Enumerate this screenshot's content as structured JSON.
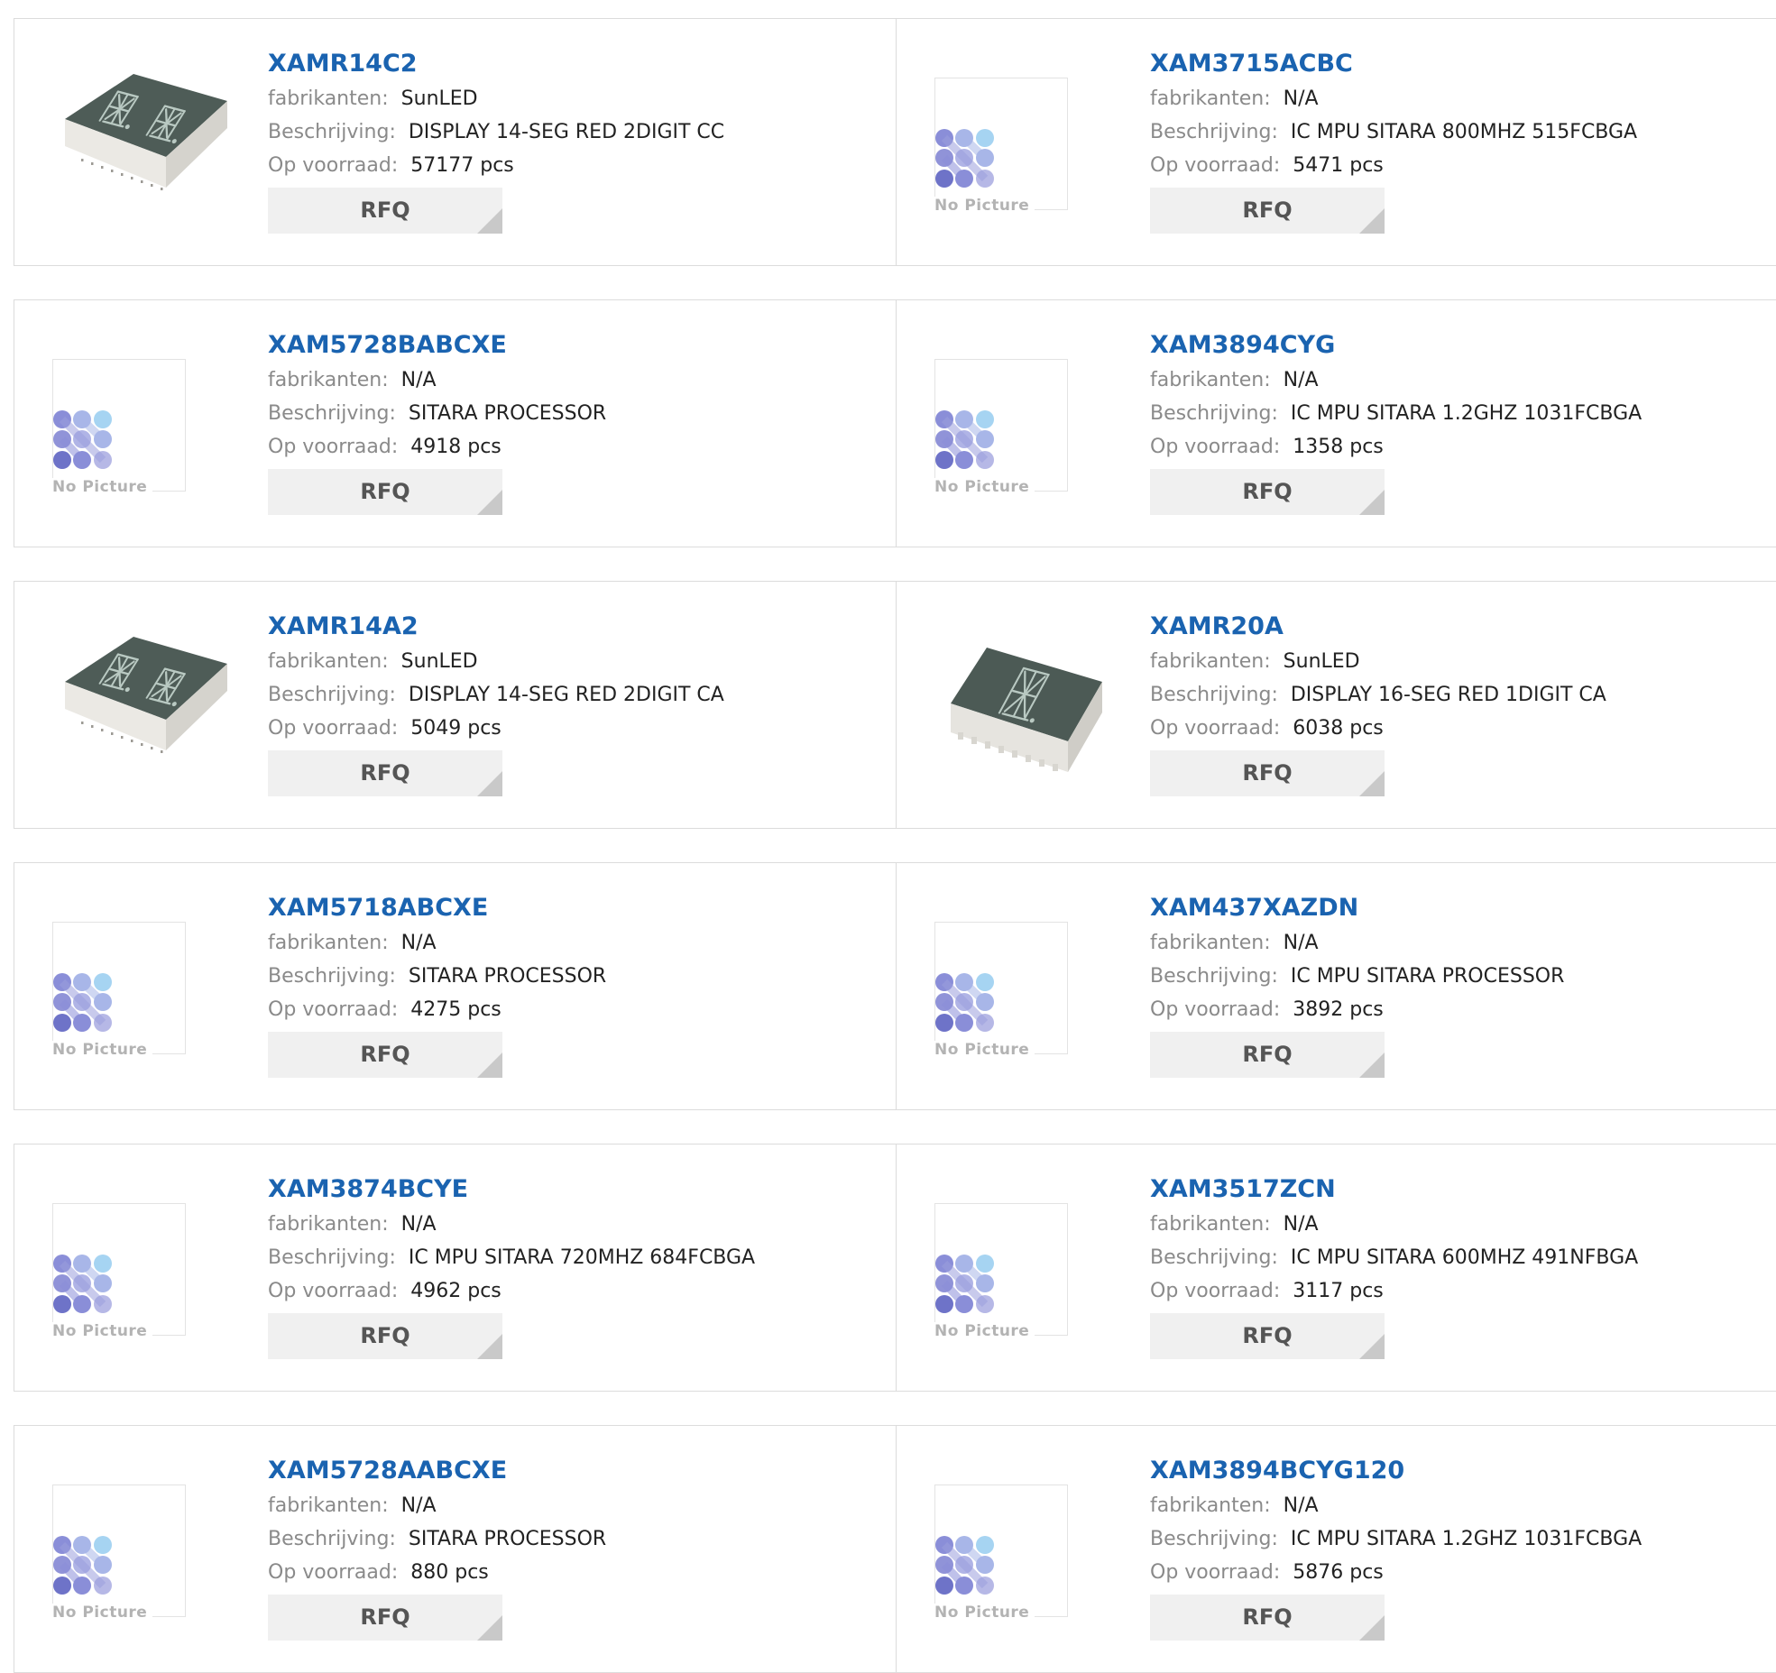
{
  "labels": {
    "manufacturer": "fabrikanten:",
    "description": "Beschrijving:",
    "stock": "Op voorraad:",
    "rfq": "RFQ",
    "no_picture": "No Picture"
  },
  "products": [
    {
      "part": "XAMR14C2",
      "manufacturer": "SunLED",
      "description": "DISPLAY 14-SEG RED 2DIGIT CC",
      "stock": "57177 pcs",
      "image": "led-2digit-icon"
    },
    {
      "part": "XAM3715ACBC",
      "manufacturer": "N/A",
      "description": "IC MPU SITARA 800MHZ 515FCBGA",
      "stock": "5471 pcs",
      "image": "no-picture-icon"
    },
    {
      "part": "XAM5728BABCXE",
      "manufacturer": "N/A",
      "description": "SITARA PROCESSOR",
      "stock": "4918 pcs",
      "image": "no-picture-icon"
    },
    {
      "part": "XAM3894CYG",
      "manufacturer": "N/A",
      "description": "IC MPU SITARA 1.2GHZ 1031FCBGA",
      "stock": "1358 pcs",
      "image": "no-picture-icon"
    },
    {
      "part": "XAMR14A2",
      "manufacturer": "SunLED",
      "description": "DISPLAY 14-SEG RED 2DIGIT CA",
      "stock": "5049 pcs",
      "image": "led-2digit-icon"
    },
    {
      "part": "XAMR20A",
      "manufacturer": "SunLED",
      "description": "DISPLAY 16-SEG RED 1DIGIT CA",
      "stock": "6038 pcs",
      "image": "led-1digit-icon"
    },
    {
      "part": "XAM5718ABCXE",
      "manufacturer": "N/A",
      "description": "SITARA PROCESSOR",
      "stock": "4275 pcs",
      "image": "no-picture-icon"
    },
    {
      "part": "XAM437XAZDN",
      "manufacturer": "N/A",
      "description": "IC MPU SITARA PROCESSOR",
      "stock": "3892 pcs",
      "image": "no-picture-icon"
    },
    {
      "part": "XAM3874BCYE",
      "manufacturer": "N/A",
      "description": "IC MPU SITARA 720MHZ 684FCBGA",
      "stock": "4962 pcs",
      "image": "no-picture-icon"
    },
    {
      "part": "XAM3517ZCN",
      "manufacturer": "N/A",
      "description": "IC MPU SITARA 600MHZ 491NFBGA",
      "stock": "3117 pcs",
      "image": "no-picture-icon"
    },
    {
      "part": "XAM5728AABCXE",
      "manufacturer": "N/A",
      "description": "SITARA PROCESSOR",
      "stock": "880 pcs",
      "image": "no-picture-icon"
    },
    {
      "part": "XAM3894BCYG120",
      "manufacturer": "N/A",
      "description": "IC MPU SITARA 1.2GHZ 1031FCBGA",
      "stock": "5876 pcs",
      "image": "no-picture-icon"
    }
  ]
}
